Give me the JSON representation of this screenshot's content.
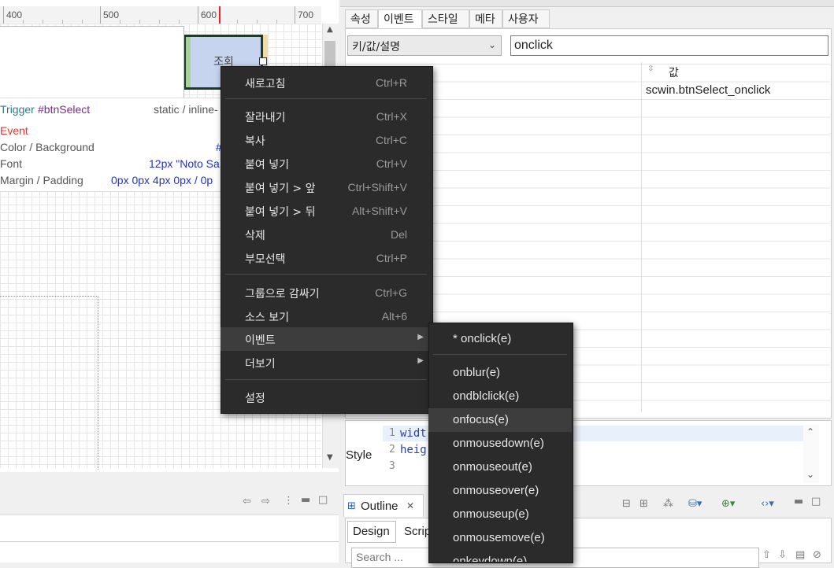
{
  "ruler": {
    "labels": [
      "400",
      "500",
      "600",
      "700"
    ]
  },
  "canvas": {
    "button_label": "조회",
    "info": {
      "trigger_label": "Trigger",
      "trigger_id": "#btnSelect",
      "position": "static / inline-",
      "event_label": "Event",
      "color_label": "Color / Background",
      "color_value": "#",
      "font_label": "Font",
      "font_value": "12px \"Noto Sa",
      "margin_label": "Margin / Padding",
      "margin_value": "0px 0px 4px 0px / 0p"
    }
  },
  "property": {
    "tabs": [
      "속성",
      "이벤트",
      "스타일",
      "메타",
      "사용자"
    ],
    "active_tab": "이벤트",
    "filter_select": "키/값/설명",
    "search_value": "onclick",
    "column_header": "값",
    "rows": [
      {
        "value": "scwin.btnSelect_onclick"
      }
    ],
    "style_label": "Style",
    "code_lines": [
      {
        "num": "1",
        "text": "widt"
      },
      {
        "num": "2",
        "text": "heig"
      },
      {
        "num": "3",
        "text": ""
      }
    ]
  },
  "outline": {
    "title": "Outline",
    "tabs": [
      "Design",
      "Scrip"
    ],
    "search_placeholder": "Search ..."
  },
  "context_menu": {
    "items": [
      {
        "label": "새로고침",
        "shortcut": "Ctrl+R"
      },
      {
        "label": "잘라내기",
        "shortcut": "Ctrl+X"
      },
      {
        "label": "복사",
        "shortcut": "Ctrl+C"
      },
      {
        "label": "붙여 넣기",
        "shortcut": "Ctrl+V"
      },
      {
        "label": "붙여 넣기 > 앞",
        "shortcut": "Ctrl+Shift+V"
      },
      {
        "label": "붙여 넣기 > 뒤",
        "shortcut": "Alt+Shift+V"
      },
      {
        "label": "삭제",
        "shortcut": "Del"
      },
      {
        "label": "부모선택",
        "shortcut": "Ctrl+P"
      },
      {
        "label": "그룹으로 감싸기",
        "shortcut": "Ctrl+G"
      },
      {
        "label": "소스 보기",
        "shortcut": "Alt+6"
      },
      {
        "label": "이벤트",
        "shortcut": ""
      },
      {
        "label": "더보기",
        "shortcut": ""
      },
      {
        "label": "설정",
        "shortcut": ""
      }
    ]
  },
  "event_submenu": {
    "items": [
      "* onclick(e)",
      "onblur(e)",
      "ondblclick(e)",
      "onfocus(e)",
      "onmousedown(e)",
      "onmouseout(e)",
      "onmouseover(e)",
      "onmouseup(e)",
      "onmousemove(e)",
      "onkeydown(e)"
    ]
  }
}
